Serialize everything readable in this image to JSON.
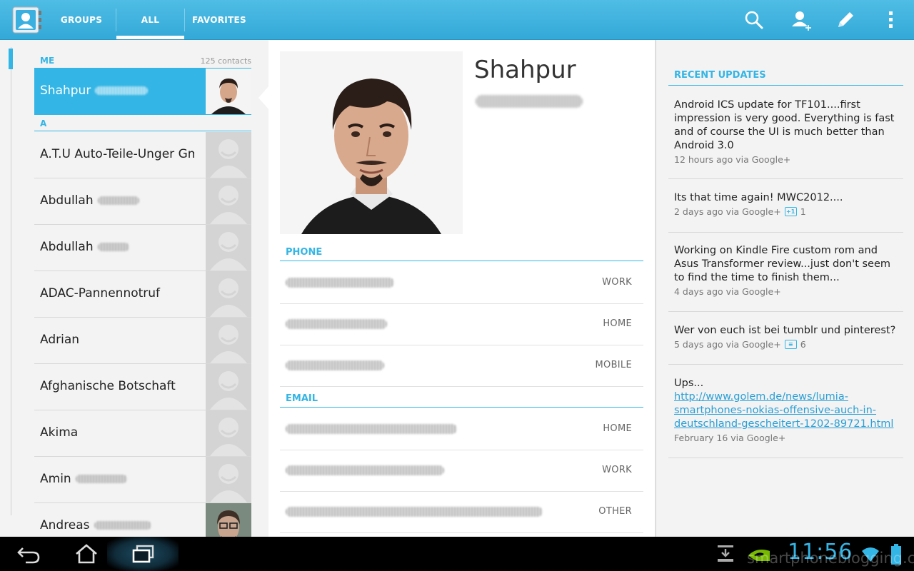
{
  "action_bar": {
    "app_icon": "contacts-card-icon",
    "tabs": [
      {
        "label": "GROUPS",
        "selected": false
      },
      {
        "label": "ALL",
        "selected": true
      },
      {
        "label": "FAVORITES",
        "selected": false
      }
    ],
    "actions": [
      "search-icon",
      "add-contact-icon",
      "edit-pencil-icon",
      "overflow-menu-icon"
    ],
    "accent_color": "#33b5e5"
  },
  "contact_list": {
    "me_header": "ME",
    "contact_count": "125 contacts",
    "me_contact": {
      "name": "Shahpur",
      "selected": true
    },
    "section_a_header": "A",
    "contacts": [
      {
        "name": "A.T.U Auto-Teile-Unger Gm",
        "has_photo": false
      },
      {
        "name": "Abdullah",
        "has_photo": false
      },
      {
        "name": "Abdullah",
        "has_photo": false
      },
      {
        "name": "ADAC-Pannennotruf",
        "has_photo": false
      },
      {
        "name": "Adrian",
        "has_photo": false
      },
      {
        "name": "Afghanische Botschaft",
        "has_photo": false
      },
      {
        "name": "Akima",
        "has_photo": false
      },
      {
        "name": "Amin",
        "has_photo": false
      },
      {
        "name": "Andreas",
        "has_photo": true
      }
    ]
  },
  "detail": {
    "name": "Shahpur",
    "phone_header": "PHONE",
    "phones": [
      {
        "type": "WORK"
      },
      {
        "type": "HOME"
      },
      {
        "type": "MOBILE"
      }
    ],
    "email_header": "EMAIL",
    "emails": [
      {
        "type": "HOME"
      },
      {
        "type": "WORK"
      },
      {
        "type": "OTHER"
      }
    ]
  },
  "recent_updates": {
    "header": "RECENT UPDATES",
    "items": [
      {
        "text": "Android ICS update for TF101....first impression is very good. Everything is fast and of course the UI is much better than Android 3.0",
        "meta": "12 hours ago via Google+",
        "badge": "",
        "badge_count": ""
      },
      {
        "text": "Its that time again! MWC2012....",
        "meta": "2 days ago via Google+",
        "badge": "plus-one-icon",
        "badge_count": "1"
      },
      {
        "text": "Working on Kindle Fire custom rom and Asus Transformer review...just don't seem to find the time to finish them...",
        "meta": "4 days ago via Google+",
        "badge": "",
        "badge_count": ""
      },
      {
        "text": "Wer von euch ist bei tumblr und pinterest?",
        "meta": "5 days ago via Google+",
        "badge": "comment-icon",
        "badge_count": "6"
      },
      {
        "text": "Ups...",
        "link": "http://www.golem.de/news/lumia-smartphones-nokias-offensive-auch-in-deutschland-gescheitert-1202-89721.html",
        "meta": "February 16 via Google+",
        "badge": "",
        "badge_count": ""
      }
    ]
  },
  "system_bar": {
    "clock": "11:56",
    "watermark": "smartphoneblogging.com",
    "nav_icons": [
      "back-icon",
      "home-icon",
      "recent-apps-icon"
    ],
    "status_icons": [
      "download-icon",
      "nvidia-icon",
      "wifi-icon",
      "battery-icon"
    ]
  }
}
